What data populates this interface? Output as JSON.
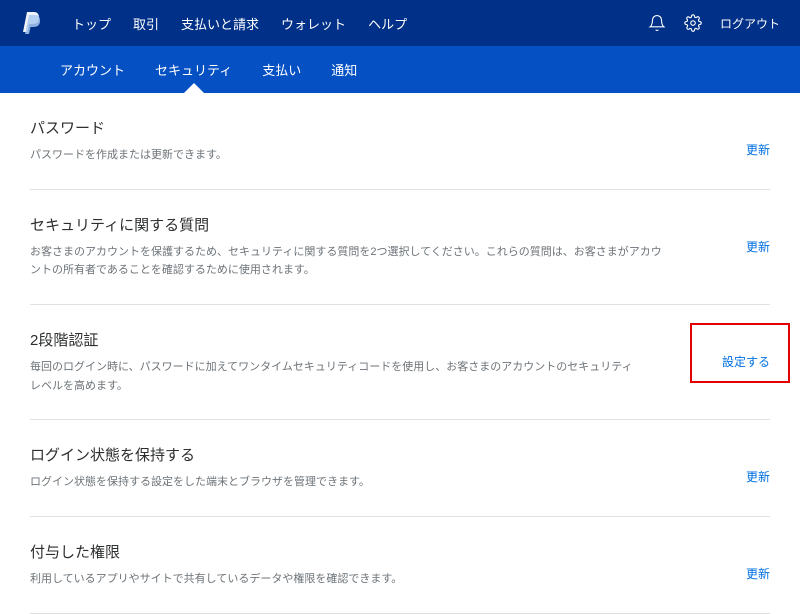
{
  "header": {
    "nav_primary": [
      {
        "label": "トップ"
      },
      {
        "label": "取引"
      },
      {
        "label": "支払いと請求"
      },
      {
        "label": "ウォレット"
      },
      {
        "label": "ヘルプ"
      }
    ],
    "logout_label": "ログアウト"
  },
  "nav_secondary": [
    {
      "label": "アカウント",
      "active": false
    },
    {
      "label": "セキュリティ",
      "active": true
    },
    {
      "label": "支払い",
      "active": false
    },
    {
      "label": "通知",
      "active": false
    }
  ],
  "sections": [
    {
      "title": "パスワード",
      "desc": "パスワードを作成または更新できます。",
      "action": "更新",
      "highlighted": false
    },
    {
      "title": "セキュリティに関する質問",
      "desc": "お客さまのアカウントを保護するため、セキュリティに関する質問を2つ選択してください。これらの質問は、お客さまがアカウントの所有者であることを確認するために使用されます。",
      "action": "更新",
      "highlighted": false
    },
    {
      "title": "2段階認証",
      "desc": "毎回のログイン時に、パスワードに加えてワンタイムセキュリティコードを使用し、お客さまのアカウントのセキュリティレベルを高めます。",
      "action": "設定する",
      "highlighted": true
    },
    {
      "title": "ログイン状態を保持する",
      "desc": "ログイン状態を保持する設定をした端末とブラウザを管理できます。",
      "action": "更新",
      "highlighted": false
    },
    {
      "title": "付与した権限",
      "desc": "利用しているアプリやサイトで共有しているデータや権限を確認できます。",
      "action": "更新",
      "highlighted": false
    }
  ]
}
